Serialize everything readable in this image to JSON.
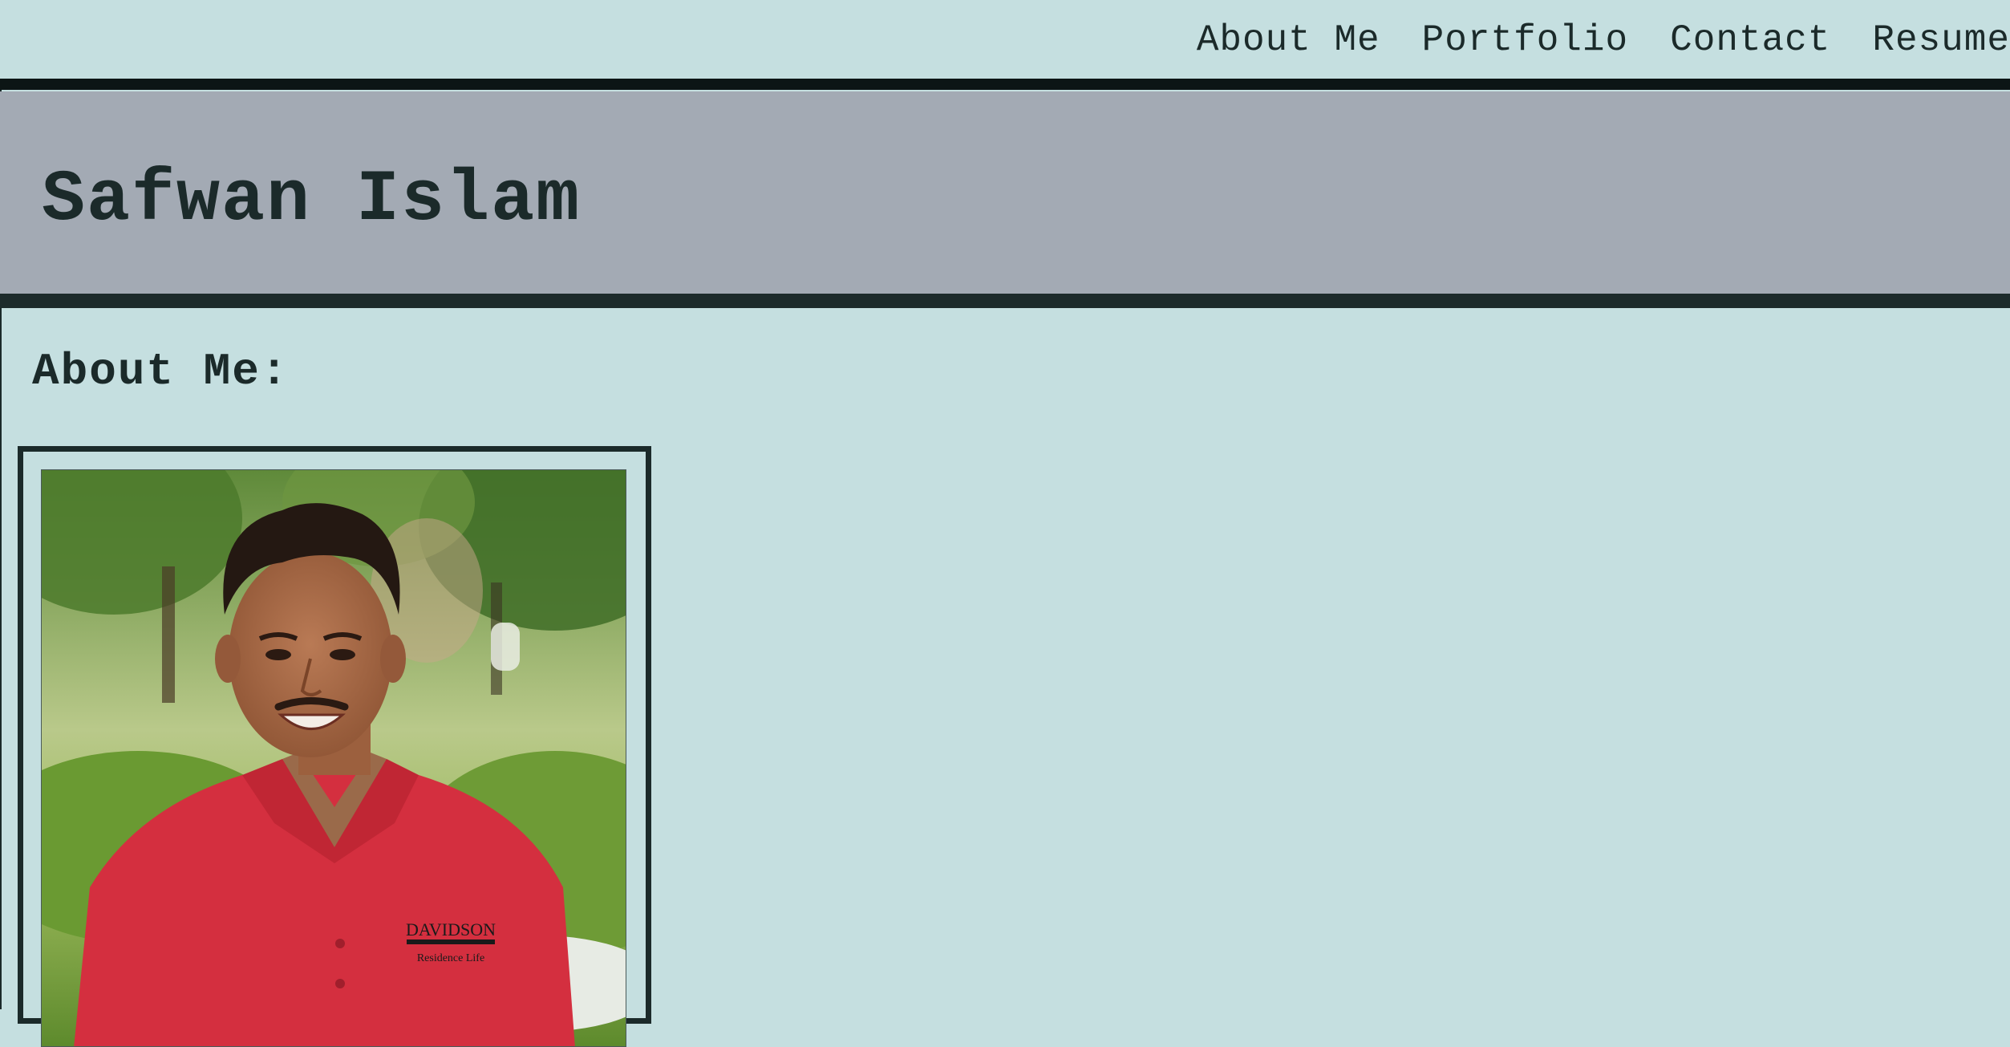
{
  "nav": {
    "items": [
      {
        "label": "About Me"
      },
      {
        "label": "Portfolio"
      },
      {
        "label": "Contact"
      },
      {
        "label": "Resume"
      }
    ]
  },
  "header": {
    "name": "Safwan Islam"
  },
  "about": {
    "heading": "About Me:",
    "photo": {
      "shirt_logo_line1": "DAVIDSON",
      "shirt_logo_line2": "Residence Life"
    }
  },
  "colors": {
    "background": "#c5dfe0",
    "banner": "#a3aab4",
    "dark": "#1b2a2a",
    "shirt": "#d42f3f"
  }
}
